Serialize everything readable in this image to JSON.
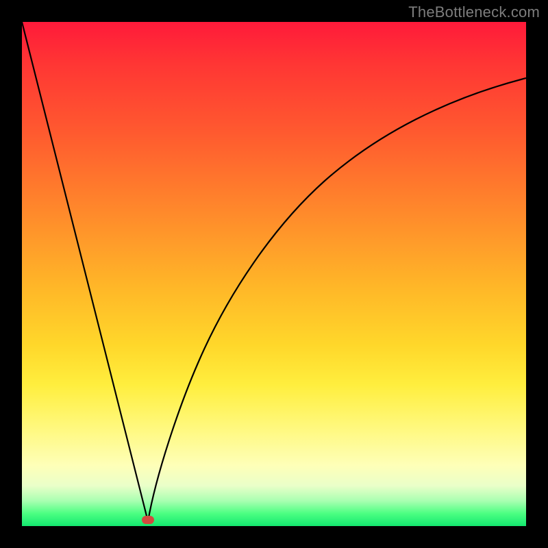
{
  "credit": "TheBottleneck.com",
  "chart_data": {
    "type": "line",
    "title": "",
    "xlabel": "",
    "ylabel": "",
    "xlim": [
      0,
      1
    ],
    "ylim": [
      0,
      1
    ],
    "grid": false,
    "series": [
      {
        "name": "curve",
        "x": [
          0.0,
          0.05,
          0.1,
          0.15,
          0.2,
          0.25,
          0.255,
          0.3,
          0.35,
          0.4,
          0.45,
          0.5,
          0.55,
          0.6,
          0.65,
          0.7,
          0.75,
          0.8,
          0.85,
          0.9,
          0.95,
          1.0
        ],
        "values": [
          1.0,
          0.8,
          0.6,
          0.4,
          0.2,
          0.01,
          0.0,
          0.14,
          0.32,
          0.46,
          0.56,
          0.64,
          0.7,
          0.75,
          0.79,
          0.82,
          0.84,
          0.86,
          0.87,
          0.88,
          0.885,
          0.89
        ]
      }
    ],
    "marker": {
      "x": 0.25,
      "y": 0.005,
      "color": "#d24a3f"
    },
    "gradient_stops": [
      {
        "pos": 0.0,
        "color": "#ff1a3a"
      },
      {
        "pos": 0.38,
        "color": "#ff8a2b"
      },
      {
        "pos": 0.72,
        "color": "#ffee3e"
      },
      {
        "pos": 0.92,
        "color": "#eaffc9"
      },
      {
        "pos": 1.0,
        "color": "#13e86f"
      }
    ]
  }
}
